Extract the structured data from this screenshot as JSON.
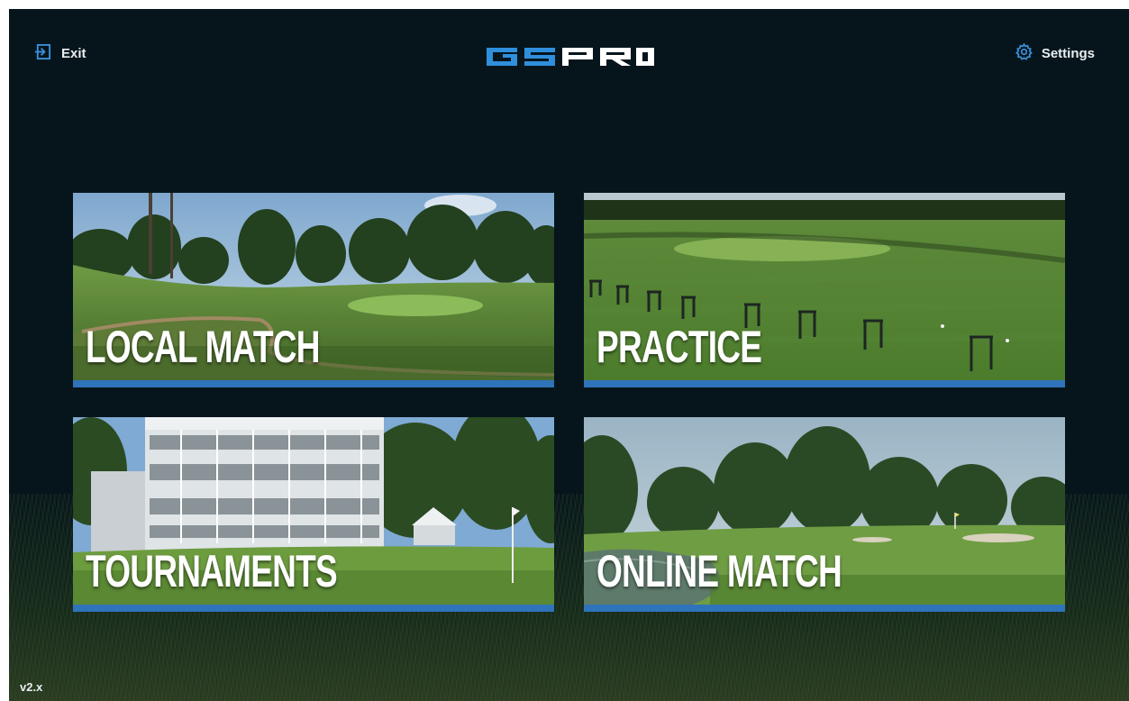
{
  "header": {
    "exit_label": "Exit",
    "logo_text": "GSPRO",
    "settings_label": "Settings"
  },
  "tiles": [
    {
      "id": "local-match",
      "label": "LOCAL MATCH"
    },
    {
      "id": "practice",
      "label": "PRACTICE"
    },
    {
      "id": "tournaments",
      "label": "TOURNAMENTS"
    },
    {
      "id": "online-match",
      "label": "ONLINE MATCH"
    }
  ],
  "footer": {
    "version": "v2.x"
  },
  "colors": {
    "background": "#06151c",
    "accent_bar": "#2f73ba",
    "logo_blue": "#2f8fdc",
    "logo_white": "#ffffff",
    "text": "#e9eef1"
  },
  "icons": {
    "exit": "exit-icon",
    "settings": "gear-icon"
  }
}
